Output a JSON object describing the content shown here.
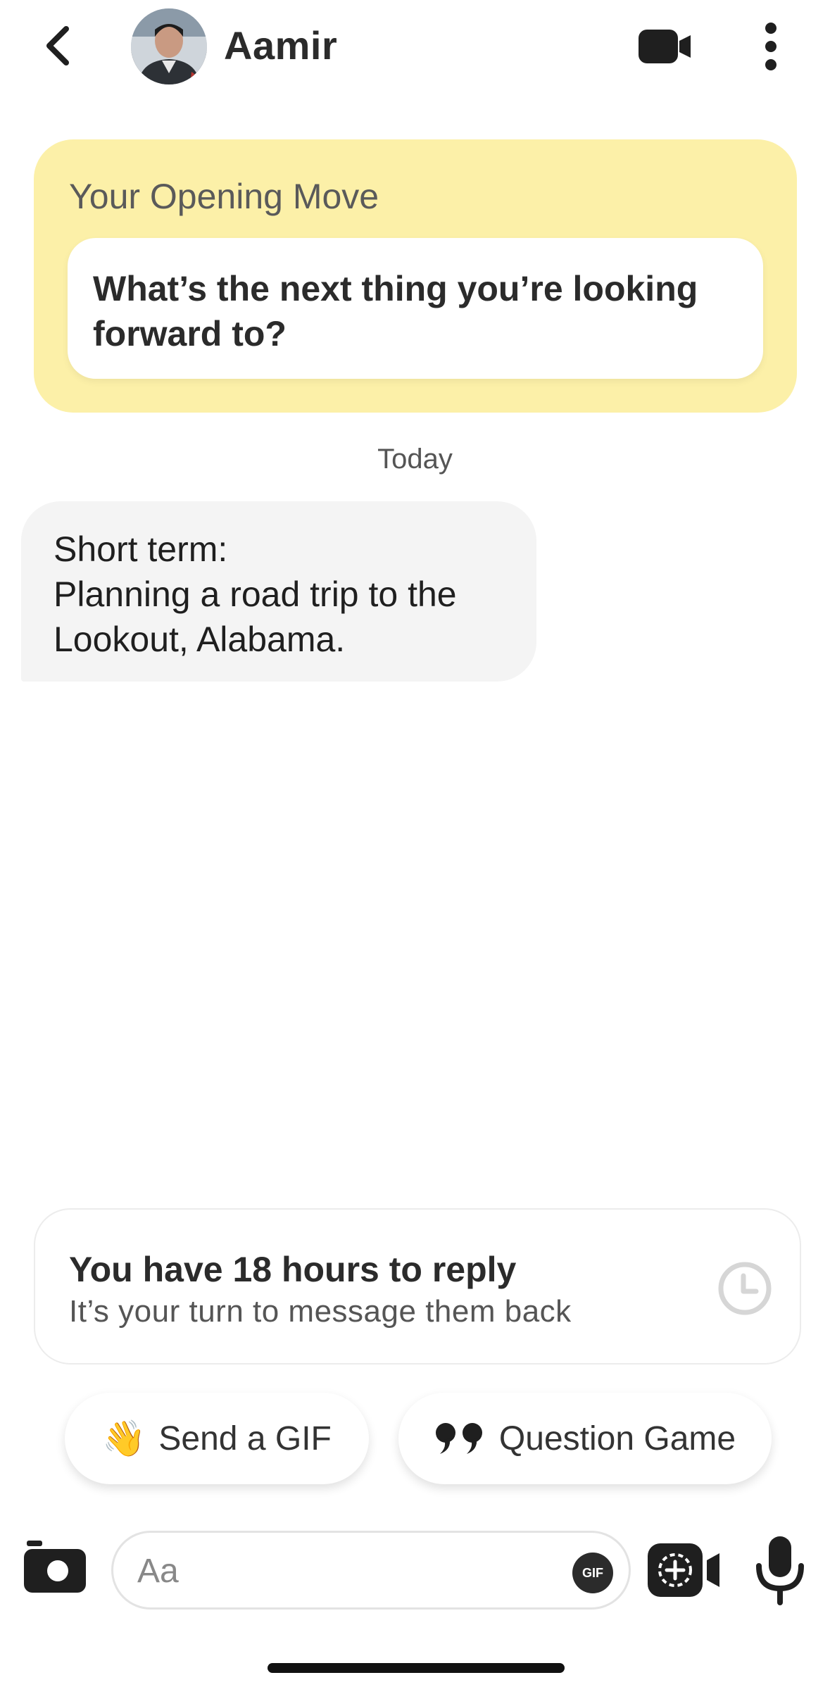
{
  "header": {
    "contact_name": "Aamir",
    "back_icon": "chevron-left-icon",
    "video_icon": "video-camera-icon",
    "more_icon": "more-vertical-icon"
  },
  "opening_move": {
    "title": "Your Opening Move",
    "question": "What’s the next thing you’re looking forward to?",
    "background_color": "#fcf0a8"
  },
  "conversation": {
    "date_separator": "Today",
    "messages": [
      {
        "text": "Short term:\nPlanning a road trip to the Lookout, Alabama."
      }
    ]
  },
  "reply_timer": {
    "title": "You have 18 hours to reply",
    "subtitle": "It’s your turn to message them back",
    "icon": "clock-icon"
  },
  "quick_actions": {
    "send_gif": {
      "emoji": "👋",
      "label": "Send a GIF"
    },
    "question_game": {
      "label": "Question Game",
      "icon": "quote-icon"
    }
  },
  "composer": {
    "placeholder": "Aa",
    "gif_label": "GIF",
    "camera_icon": "camera-icon",
    "video_note_icon": "video-message-icon",
    "mic_icon": "microphone-icon"
  }
}
